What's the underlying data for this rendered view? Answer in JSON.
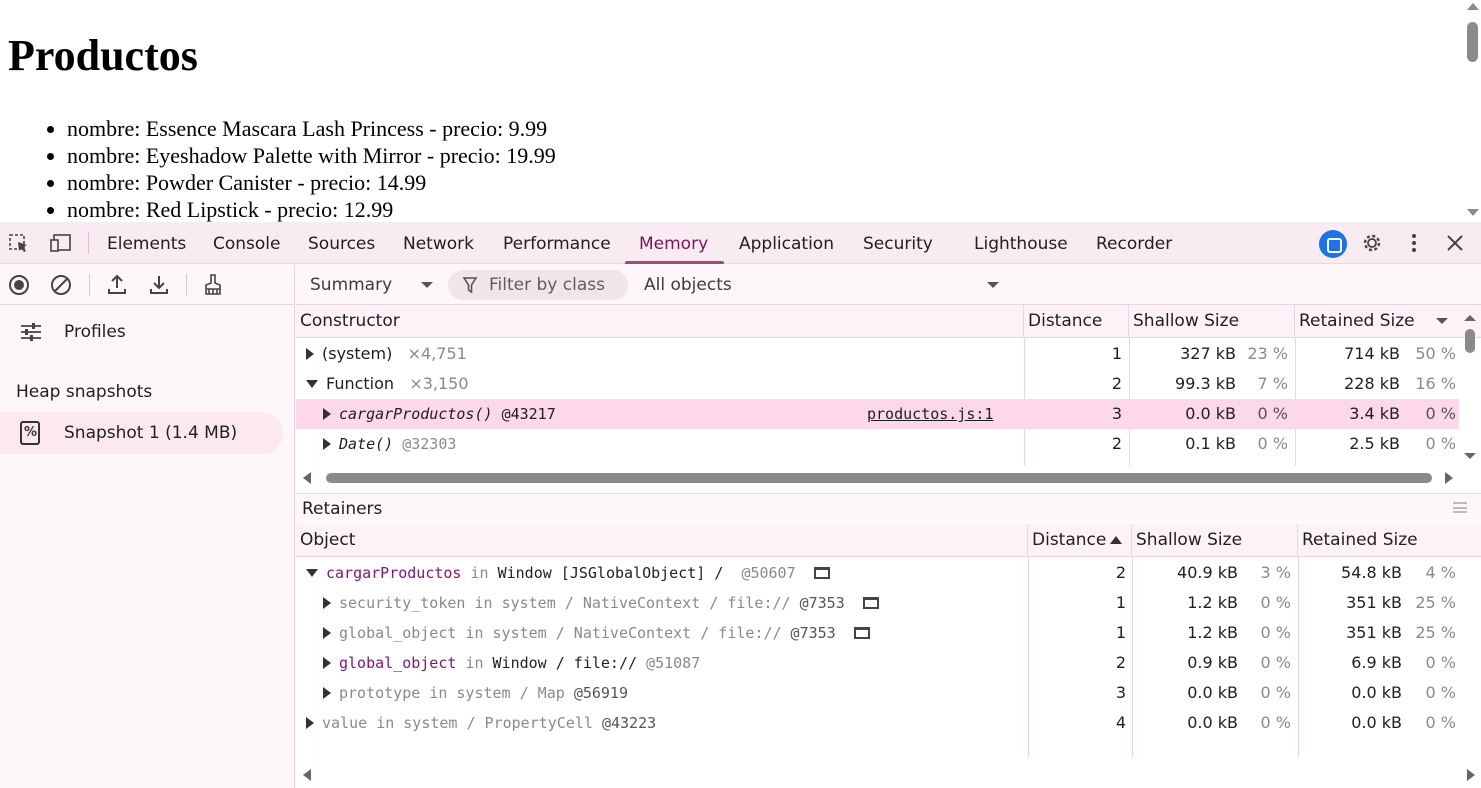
{
  "page": {
    "heading": "Productos",
    "items": [
      "nombre: Essence Mascara Lash Princess - precio: 9.99",
      "nombre: Eyeshadow Palette with Mirror - precio: 19.99",
      "nombre: Powder Canister - precio: 14.99",
      "nombre: Red Lipstick - precio: 12.99"
    ]
  },
  "devtools": {
    "tabs": [
      "Elements",
      "Console",
      "Sources",
      "Network",
      "Performance",
      "Memory",
      "Application",
      "Security",
      "Lighthouse",
      "Recorder"
    ],
    "active_tab": "Memory",
    "icons": {
      "inspect": "inspect-element-icon",
      "device": "device-toolbar-icon",
      "ai": "ai-assistance-icon",
      "settings": "gear-icon",
      "more": "kebab-menu-icon",
      "close": "close-icon"
    }
  },
  "sidebar": {
    "profiles_label": "Profiles",
    "heap_title": "Heap snapshots",
    "snapshot_label": "Snapshot 1 (1.4 MB)"
  },
  "filters": {
    "view": "Summary",
    "class_filter_placeholder": "Filter by class",
    "objects": "All objects"
  },
  "constructor_grid": {
    "headers": {
      "constructor": "Constructor",
      "distance": "Distance",
      "shallow": "Shallow Size",
      "retained": "Retained Size"
    },
    "rows": [
      {
        "name": "(system)",
        "count": "×4,751",
        "distance": "1",
        "shallow": "327 kB",
        "shallow_pct": "23 %",
        "retained": "714 kB",
        "retained_pct": "50 %"
      },
      {
        "name": "Function",
        "count": "×3,150",
        "distance": "2",
        "shallow": "99.3 kB",
        "shallow_pct": "7 %",
        "retained": "228 kB",
        "retained_pct": "16 %"
      },
      {
        "name": "cargarProductos()",
        "id": "@43217",
        "link": "productos.js:1",
        "distance": "3",
        "shallow": "0.0 kB",
        "shallow_pct": "0 %",
        "retained": "3.4 kB",
        "retained_pct": "0 %"
      },
      {
        "name": "Date()",
        "id": "@32303",
        "distance": "2",
        "shallow": "0.1 kB",
        "shallow_pct": "0 %",
        "retained": "2.5 kB",
        "retained_pct": "0 %"
      }
    ]
  },
  "retainers": {
    "title": "Retainers",
    "headers": {
      "object": "Object",
      "distance": "Distance",
      "shallow": "Shallow Size",
      "retained": "Retained Size"
    },
    "rows": [
      {
        "name": "cargarProductos",
        "in": "in",
        "ctx": "Window [JSGlobalObject] /",
        "id": "@50607",
        "distance": "2",
        "shallow": "40.9 kB",
        "shallow_pct": "3 %",
        "retained": "54.8 kB",
        "retained_pct": "4 %"
      },
      {
        "name": "security_token",
        "in": "in",
        "ctx": "system / NativeContext / file://",
        "id": "@7353",
        "distance": "1",
        "shallow": "1.2 kB",
        "shallow_pct": "0 %",
        "retained": "351 kB",
        "retained_pct": "25 %"
      },
      {
        "name": "global_object",
        "in": "in",
        "ctx": "system / NativeContext / file://",
        "id": "@7353",
        "distance": "1",
        "shallow": "1.2 kB",
        "shallow_pct": "0 %",
        "retained": "351 kB",
        "retained_pct": "25 %"
      },
      {
        "name": "global_object",
        "in": "in",
        "ctx": "Window / file://",
        "id": "@51087",
        "distance": "2",
        "shallow": "0.9 kB",
        "shallow_pct": "0 %",
        "retained": "6.9 kB",
        "retained_pct": "0 %"
      },
      {
        "name": "prototype",
        "in": "in",
        "ctx": "system / Map",
        "id": "@56919",
        "distance": "3",
        "shallow": "0.0 kB",
        "shallow_pct": "0 %",
        "retained": "0.0 kB",
        "retained_pct": "0 %"
      },
      {
        "name": "value",
        "in": "in",
        "ctx": "system / PropertyCell",
        "id": "@43223",
        "distance": "4",
        "shallow": "0.0 kB",
        "shallow_pct": "0 %",
        "retained": "0.0 kB",
        "retained_pct": "0 %"
      }
    ]
  },
  "colors": {
    "accent": "#a9467c",
    "selected_row": "#fdd8ea",
    "ai_button": "#1a73e8"
  }
}
